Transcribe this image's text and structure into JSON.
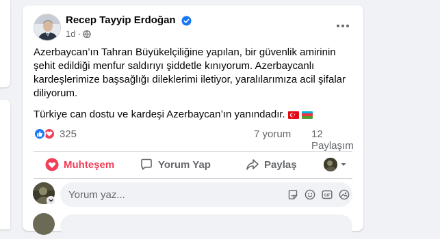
{
  "post": {
    "author": "Recep Tayyip Erdoğan",
    "time": "1d",
    "time_separator": "·",
    "paragraph1": "Azerbaycan’ın Tahran Büyükelçiliğine yapılan, bir güvenlik amirinin şehit edildiği menfur saldırıyı şiddetle kınıyorum. Azerbaycanlı kardeşlerimize başsağlığı dileklerimi iletiyor, yaralılarımıza acil şifalar diliyorum.",
    "paragraph2": "Türkiye can dostu ve kardeşi Azerbaycan’ın yanındadır."
  },
  "stats": {
    "reaction_count": "325",
    "comments": "7 yorum",
    "shares": "12 Paylaşım"
  },
  "actions": {
    "react_label": "Muhteşem",
    "comment_label": "Yorum Yap",
    "share_label": "Paylaş"
  },
  "comment_box": {
    "placeholder": "Yorum yaz..."
  },
  "colors": {
    "accent": "#1877f2",
    "love": "#f33e58",
    "muted_text": "#65676b"
  },
  "icons": [
    "verified-icon",
    "globe-icon",
    "more-icon",
    "like-icon",
    "love-icon",
    "heart-icon",
    "comment-icon",
    "share-icon",
    "chevron-down-icon",
    "sticker-icon",
    "emoji-icon",
    "gif-icon",
    "camera-icon"
  ]
}
